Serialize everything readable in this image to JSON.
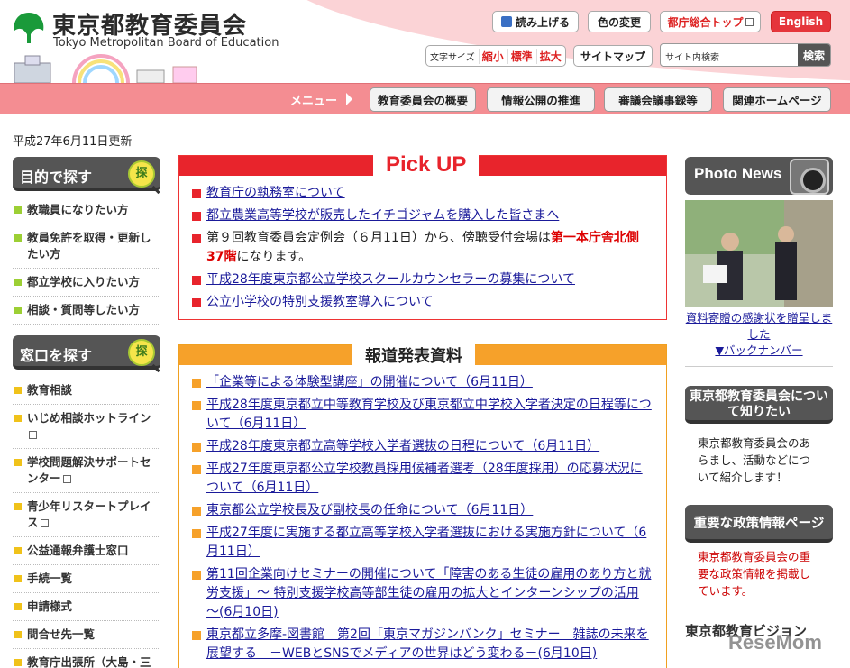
{
  "header": {
    "title": "東京都教育委員会",
    "subtitle": "Tokyo Metropolitan Board of Education",
    "read_aloud": "読み上げる",
    "color_change": "色の変更",
    "tokyo_top": "都庁総合トップ",
    "english": "English",
    "font_size_label": "文字サイズ",
    "font_small": "縮小",
    "font_standard": "標準",
    "font_large": "拡大",
    "sitemap": "サイトマップ",
    "search_placeholder": "サイト内検索",
    "search_button": "検索"
  },
  "menu": {
    "label": "メニュー",
    "items": [
      "教育委員会の概要",
      "情報公開の推進",
      "審議会議事録等",
      "関連ホームページ"
    ]
  },
  "updated": "平成27年6月11日更新",
  "left": {
    "purpose_title": "目的で探す",
    "purpose_icon_char": "探",
    "purpose_items": [
      "教職員になりたい方",
      "教員免許を取得・更新したい方",
      "都立学校に入りたい方",
      "相談・質問等したい方"
    ],
    "window_title": "窓口を探す",
    "window_icon_char": "探",
    "window_items": [
      "教育相談",
      "いじめ相談ホットライン",
      "学校問題解決サポートセンター",
      "青少年リスタートプレイス",
      "公益通報弁護士窓口",
      "手続一覧",
      "申請様式",
      "問合せ先一覧",
      "教育庁出張所（大島・三宅・八丈）"
    ]
  },
  "pickup": {
    "title": "Pick UP",
    "items": [
      "教育庁の執務室について",
      "都立農業高等学校が販売したイチゴジャムを購入した皆さまへ",
      "平成28年度東京都公立学校スクールカウンセラーの募集について",
      "公立小学校の特別支援教室導入について"
    ],
    "notice_before": "第９回教育委員会定例会（６月11日）から、傍聴受付会場は",
    "notice_highlight": "第一本庁舎北側37階",
    "notice_after": "になります。"
  },
  "press": {
    "title": "報道発表資料",
    "items": [
      "「企業等による体験型講座」の開催について（6月11日）",
      "平成28年度東京都立中等教育学校及び東京都立中学校入学者決定の日程等について（6月11日）",
      "平成28年度東京都立高等学校入学者選抜の日程について（6月11日）",
      "平成27年度東京都公立学校教員採用候補者選考（28年度採用）の応募状況について（6月11日）",
      "東京都公立学校長及び副校長の任命について（6月11日）",
      "平成27年度に実施する都立高等学校入学者選抜における実施方針について（6月11日）",
      "第11回企業向けセミナーの開催について「障害のある生徒の雇用のあり方と就労支援」～ 特別支援学校高等部生徒の雇用の拡大とインターンシップの活用 ～(6月10日)",
      "東京都立多摩-図書館　第2回「東京マガジンバンク」セミナー　雑誌の未来を展望する　－WEBとSNSでメディアの世界はどう変わる－(6月10日)"
    ]
  },
  "right": {
    "photo_news_title": "Photo News",
    "photo_caption": "資料寄贈の感謝状を贈呈しました",
    "back_number": "▼バックナンバー",
    "about_title": "東京都教育委員会について知りたい",
    "about_text": "東京都教育委員会のあらまし、活動などについて紹介します！",
    "policy_title": "重要な政策情報ページ",
    "policy_text": "東京都教育委員会の重要な政策情報を掲載しています。",
    "vision_title": "東京都教育ビジョン",
    "watermark": "ReseMom"
  },
  "colors": {
    "accent_red": "#e8242c",
    "accent_orange": "#f6a12a",
    "menu_pink": "#f48d92",
    "english_button": "#e5353b"
  }
}
